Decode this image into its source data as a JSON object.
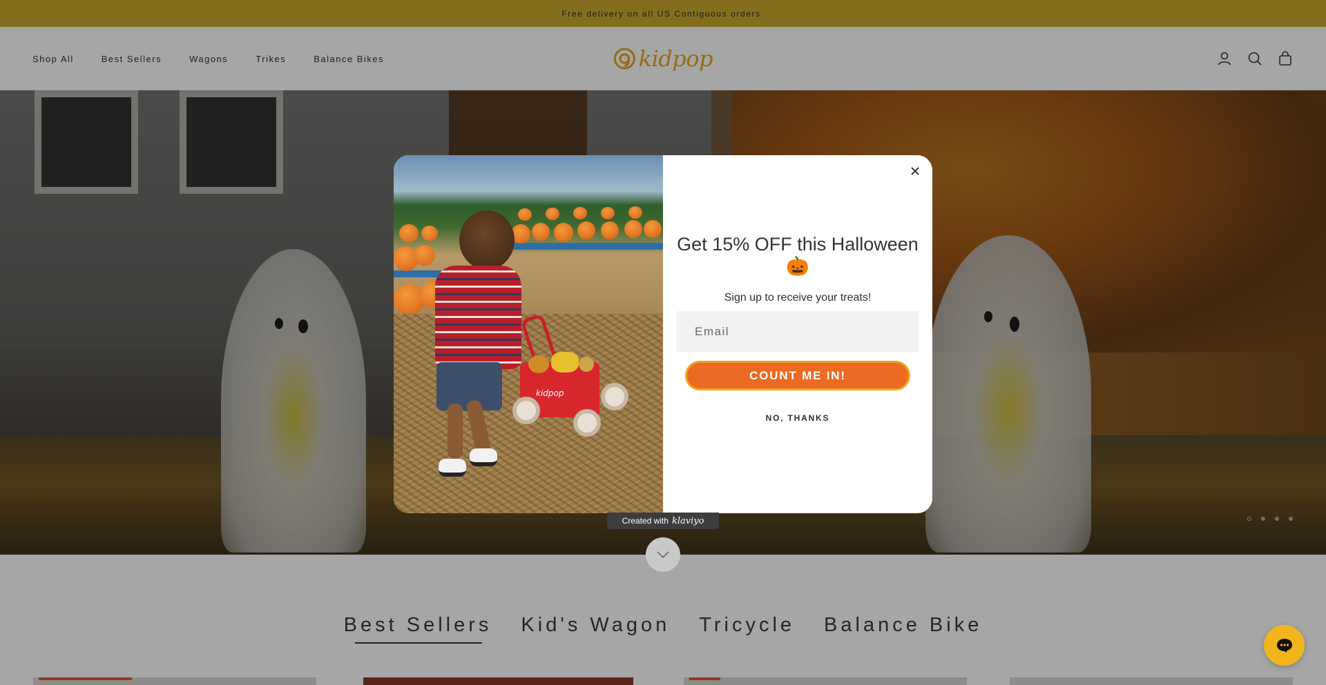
{
  "announcement": {
    "text": "Free delivery on all US Contiguous orders."
  },
  "header": {
    "nav": [
      {
        "label": "Shop All"
      },
      {
        "label": "Best Sellers"
      },
      {
        "label": "Wagons"
      },
      {
        "label": "Trikes"
      },
      {
        "label": "Balance Bikes"
      }
    ],
    "logo_text": "kidpop",
    "icons": [
      "account-icon",
      "search-icon",
      "cart-icon"
    ]
  },
  "hero": {
    "slides_count": 4,
    "active_slide": 1
  },
  "category_tabs": [
    {
      "label": "Best Sellers",
      "active": true
    },
    {
      "label": "Kid's Wagon",
      "active": false
    },
    {
      "label": "Tricycle",
      "active": false
    },
    {
      "label": "Balance Bike",
      "active": false
    }
  ],
  "popup": {
    "headline": "Get 15% OFF this Halloween 🎃",
    "subtext": "Sign up to receive your treats!",
    "email_placeholder": "Email",
    "email_value": "",
    "cta_label": "COUNT ME IN!",
    "decline_label": "NO, THANKS",
    "close_label": "×",
    "image_wagon_label": "kidpop"
  },
  "klaviyo_badge": {
    "prefix": "Created with",
    "brand": "klaviyo"
  },
  "colors": {
    "announcement_bg": "#c9a92e",
    "cta_bg": "#ec6a23",
    "cta_border": "#f0a21f",
    "logo": "#e7a521",
    "chat_bg": "#f0b51b",
    "sale_badge": "#e2582a"
  }
}
